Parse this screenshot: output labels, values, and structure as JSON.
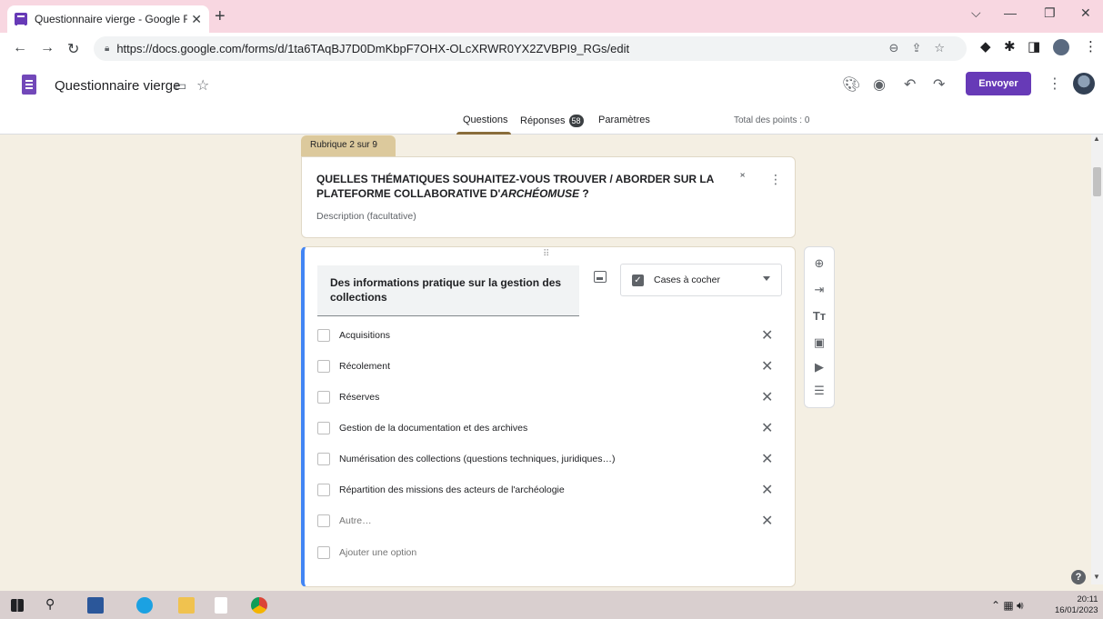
{
  "browser": {
    "tab_title": "Questionnaire vierge - Google Fo",
    "tab_close": "✕",
    "new_tab": "+",
    "url": "https://docs.google.com/forms/d/1ta6TAqBJ7D0DmKbpF7OHX-OLcXRWR0YX2ZVBPI9_RGs/edit",
    "window_minimize": "—",
    "window_restore": "❐",
    "window_close": "✕",
    "chevron": "⌵"
  },
  "header": {
    "doc_title": "Questionnaire vierge",
    "send_label": "Envoyer",
    "tabs": {
      "questions": "Questions",
      "responses": "Réponses",
      "responses_count": "58",
      "settings": "Paramètres"
    },
    "total_points": "Total des points : 0"
  },
  "section": {
    "tag": "Rubrique 2 sur 9",
    "title_prefix": "QUELLES THÉMATIQUES SOUHAITEZ-VOUS TROUVER / ABORDER SUR LA PLATEFORME COLLABORATIVE D'",
    "title_italic": "ARCHÉOMUSE",
    "title_suffix": " ?",
    "description_placeholder": "Description (facultative)"
  },
  "question": {
    "title": "Des informations pratique sur la gestion des collections",
    "type_label": "Cases à cocher",
    "options": [
      "Acquisitions",
      "Récolement",
      "Réserves",
      "Gestion de la documentation et des archives",
      "Numérisation des collections (questions techniques, juridiques…)",
      "Répartition des missions des acteurs de l'archéologie"
    ],
    "other_option": "Autre…",
    "add_option": "Ajouter une option"
  },
  "taskbar": {
    "time": "20:11",
    "date": "16/01/2023"
  },
  "colors": {
    "accent": "#673ab7",
    "page_bg": "#f4efe3",
    "section_tag": "#dcc99c",
    "active_border": "#4285f4"
  }
}
